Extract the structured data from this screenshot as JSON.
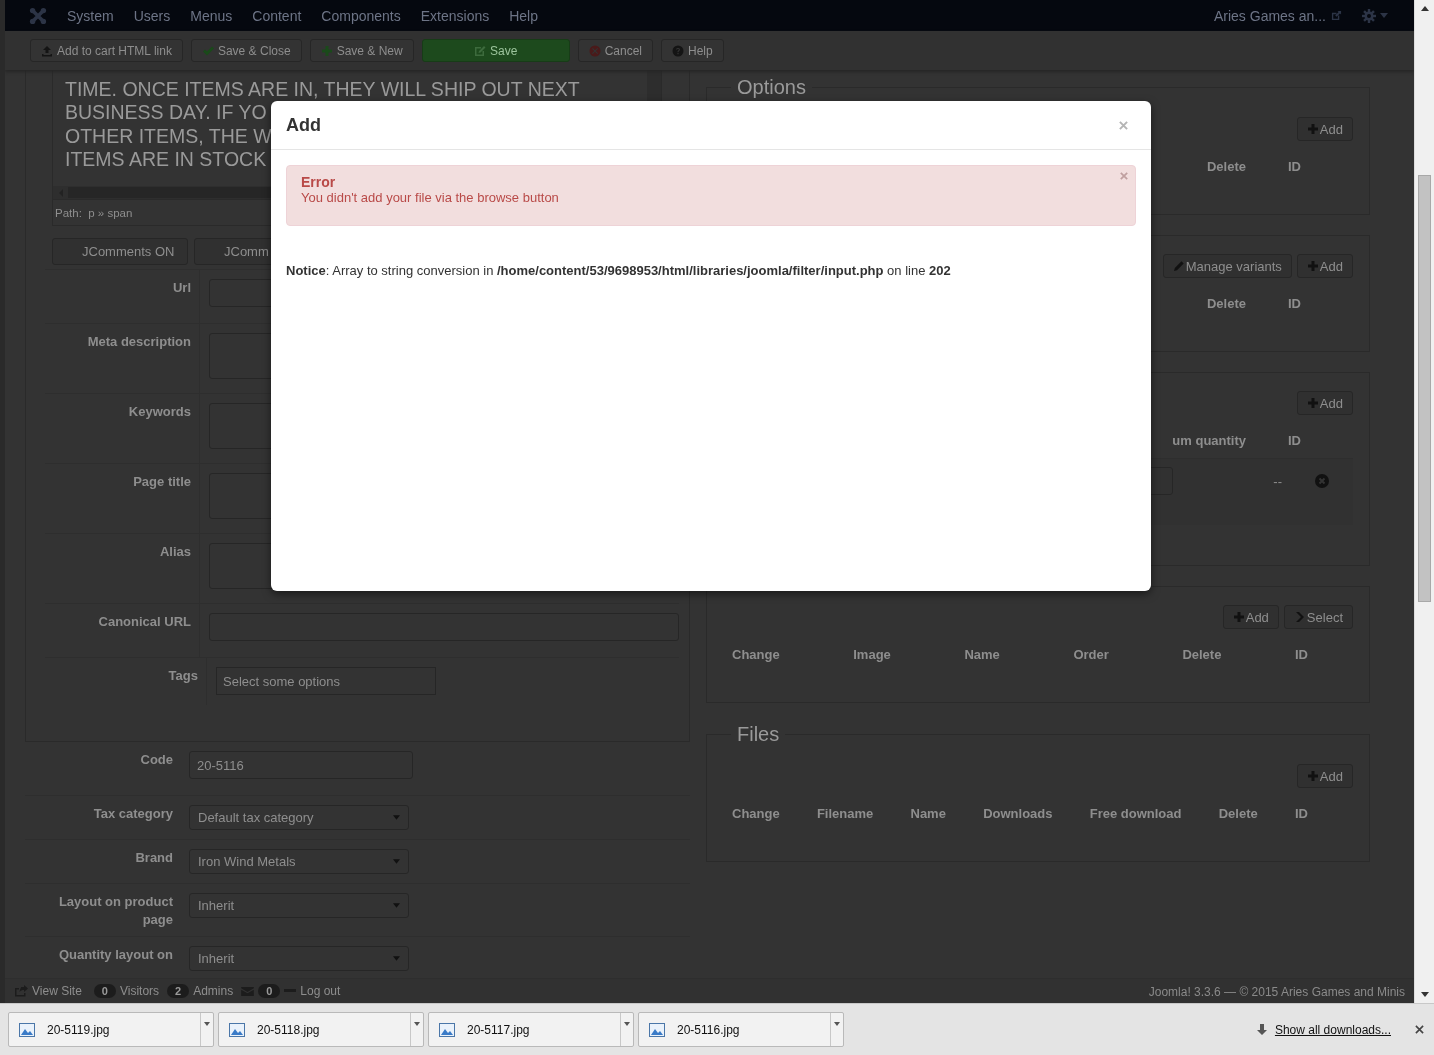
{
  "navbar": {
    "menu": [
      "System",
      "Users",
      "Menus",
      "Content",
      "Components",
      "Extensions",
      "Help"
    ],
    "site_link": "Aries Games an..."
  },
  "toolbar": {
    "buttons": [
      {
        "label": "Add to cart HTML link",
        "kind": "upload"
      },
      {
        "label": "Save & Close",
        "kind": "check"
      },
      {
        "label": "Save & New",
        "kind": "plus"
      },
      {
        "label": "Save",
        "kind": "save"
      },
      {
        "label": "Cancel",
        "kind": "cancel"
      },
      {
        "label": "Help",
        "kind": "help"
      }
    ]
  },
  "editor": {
    "lines": [
      "TIME. ONCE ITEMS ARE IN, THEY WILL SHIP OUT NEXT",
      "BUSINESS DAY. IF YO",
      "OTHER ITEMS, THE W",
      "ITEMS ARE IN STOCK"
    ],
    "path": "Path:  p » span"
  },
  "comment_buttons": [
    "JComments ON",
    "JComm"
  ],
  "meta_fields": [
    {
      "label": "Url",
      "kind": "input"
    },
    {
      "label": "Meta description",
      "kind": "textarea"
    },
    {
      "label": "Keywords",
      "kind": "textarea"
    },
    {
      "label": "Page title",
      "kind": "textarea"
    },
    {
      "label": "Alias",
      "kind": "textarea"
    },
    {
      "label": "Canonical URL",
      "kind": "wide"
    },
    {
      "label": "Tags",
      "kind": "tags",
      "placeholder": "Select some options"
    }
  ],
  "product_fields": [
    {
      "label": "Code",
      "kind": "input",
      "value": "20-5116"
    },
    {
      "label": "Tax category",
      "kind": "select",
      "value": "Default tax category"
    },
    {
      "label": "Brand",
      "kind": "select",
      "value": "Iron Wind Metals"
    },
    {
      "label": "Layout on product page",
      "kind": "select",
      "value": "Inherit"
    },
    {
      "label": "Quantity layout on",
      "kind": "select",
      "value": "Inherit"
    }
  ],
  "panels": [
    {
      "legend": "Options",
      "buttons": [
        {
          "label": "Add",
          "kind": "add"
        }
      ],
      "columns": [
        "Delete",
        "ID"
      ]
    },
    {
      "buttons": [
        {
          "label": "Manage variants",
          "kind": "edit"
        },
        {
          "label": "Add",
          "kind": "add"
        }
      ],
      "columns": [
        "Delete",
        "ID"
      ]
    },
    {
      "buttons": [
        {
          "label": "Add",
          "kind": "add"
        }
      ],
      "columns": [
        "um quantity",
        "ID"
      ],
      "rows": [
        {
          "cells": [
            "--"
          ]
        }
      ]
    },
    {
      "buttons": [
        {
          "label": "Add",
          "kind": "add"
        },
        {
          "label": "Select",
          "kind": "select"
        }
      ],
      "columns": [
        "Change",
        "Image",
        "Name",
        "Order",
        "Delete",
        "ID"
      ]
    },
    {
      "legend": "Files",
      "buttons": [
        {
          "label": "Add",
          "kind": "add"
        }
      ],
      "columns": [
        "Change",
        "Filename",
        "Name",
        "Downloads",
        "Free download",
        "Delete",
        "ID"
      ]
    }
  ],
  "status_bar": {
    "items": [
      {
        "kind": "view",
        "text": "View Site"
      },
      {
        "kind": "badge",
        "text": "0"
      },
      {
        "kind": "label",
        "text": "Visitors"
      },
      {
        "kind": "badge",
        "text": "2"
      },
      {
        "kind": "label",
        "text": "Admins"
      },
      {
        "kind": "mail"
      },
      {
        "kind": "badge",
        "text": "0"
      },
      {
        "kind": "logout",
        "text": "Log out"
      }
    ],
    "copyright": "Joomla! 3.3.6 — © 2015 Aries Games and Minis"
  },
  "modal": {
    "title": "Add",
    "alert": {
      "heading": "Error",
      "message": "You didn't add your file via the browse button"
    },
    "notice": "**Notice**: Array to string conversion in **/home/content/53/9698953/html/libraries/joomla/filter/input.php** on line **202**"
  },
  "downloads": {
    "items": [
      "20-5119.jpg",
      "20-5118.jpg",
      "20-5117.jpg",
      "20-5116.jpg"
    ],
    "show_all": "Show all downloads..."
  }
}
